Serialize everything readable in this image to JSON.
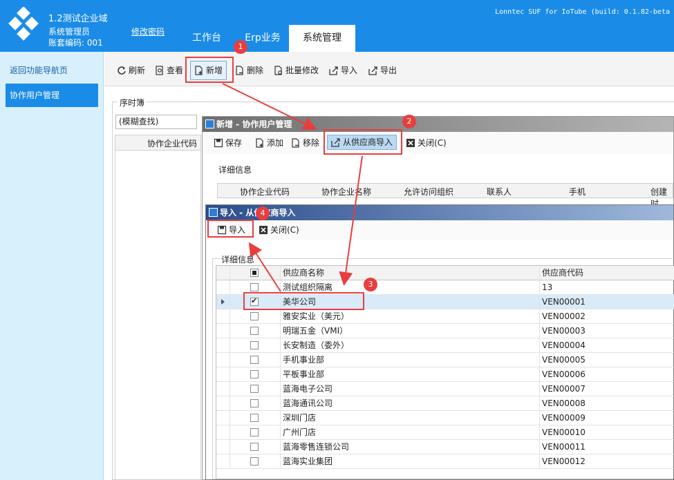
{
  "header": {
    "org_name": "1.2测试企业域",
    "user_role": "系统管理员",
    "account_code": "账套编码: 001",
    "change_password": "修改密码",
    "build_info": "Lonntec SUF for IoTube (build: 0.1.82-beta",
    "tabs": [
      {
        "label": "工作台"
      },
      {
        "label": "Erp业务"
      },
      {
        "label": "系统管理"
      }
    ]
  },
  "sidebar": {
    "items": [
      {
        "label": "返回功能导航页"
      },
      {
        "label": "协作用户管理"
      }
    ]
  },
  "toolbar": {
    "buttons": [
      {
        "label": "刷新"
      },
      {
        "label": "查看"
      },
      {
        "label": "新增"
      },
      {
        "label": "删除"
      },
      {
        "label": "批量修改"
      },
      {
        "label": "导入"
      },
      {
        "label": "导出"
      }
    ]
  },
  "seq_panel": {
    "label": "序时簿",
    "search_value": "(模糊查找)",
    "column": "协作企业代码"
  },
  "dialog1": {
    "title": "新增 - 协作用户管理",
    "buttons": [
      {
        "label": "保存"
      },
      {
        "label": "添加"
      },
      {
        "label": "移除"
      },
      {
        "label": "从供应商导入"
      },
      {
        "label": "关闭(C)"
      }
    ],
    "detail_label": "详细信息",
    "columns": [
      "协作企业代码",
      "协作企业名称",
      "允许访问组织",
      "联系人",
      "手机",
      "创建时"
    ]
  },
  "dialog2": {
    "title": "导入 - 从供应商导入",
    "buttons": [
      {
        "label": "导入"
      },
      {
        "label": "关闭(C)"
      }
    ],
    "detail_label": "详细信息",
    "columns": {
      "name": "供应商名称",
      "code": "供应商代码"
    },
    "rows": [
      {
        "name": "测试组织隔离",
        "code": "13",
        "checked": false
      },
      {
        "name": "美华公司",
        "code": "VEN00001",
        "checked": true
      },
      {
        "name": "雅安实业（美元）",
        "code": "VEN00002",
        "checked": false
      },
      {
        "name": "明瑞五金（VMI）",
        "code": "VEN00003",
        "checked": false
      },
      {
        "name": "长安制造（委外）",
        "code": "VEN00004",
        "checked": false
      },
      {
        "name": "手机事业部",
        "code": "VEN00005",
        "checked": false
      },
      {
        "name": "平板事业部",
        "code": "VEN00006",
        "checked": false
      },
      {
        "name": "蓝海电子公司",
        "code": "VEN00007",
        "checked": false
      },
      {
        "name": "蓝海通讯公司",
        "code": "VEN00008",
        "checked": false
      },
      {
        "name": "深圳门店",
        "code": "VEN00009",
        "checked": false
      },
      {
        "name": "广州门店",
        "code": "VEN00010",
        "checked": false
      },
      {
        "name": "蓝海零售连锁公司",
        "code": "VEN00011",
        "checked": false
      },
      {
        "name": "蓝海实业集团",
        "code": "VEN00012",
        "checked": false
      }
    ]
  },
  "annotations": {
    "badges": [
      "1",
      "2",
      "3",
      "4"
    ],
    "color": "#e83e3e"
  },
  "colors": {
    "header_blue": "#1a8ce8",
    "sidebar_bg": "#d8f0fc",
    "selected_row": "#d9eaf8"
  }
}
